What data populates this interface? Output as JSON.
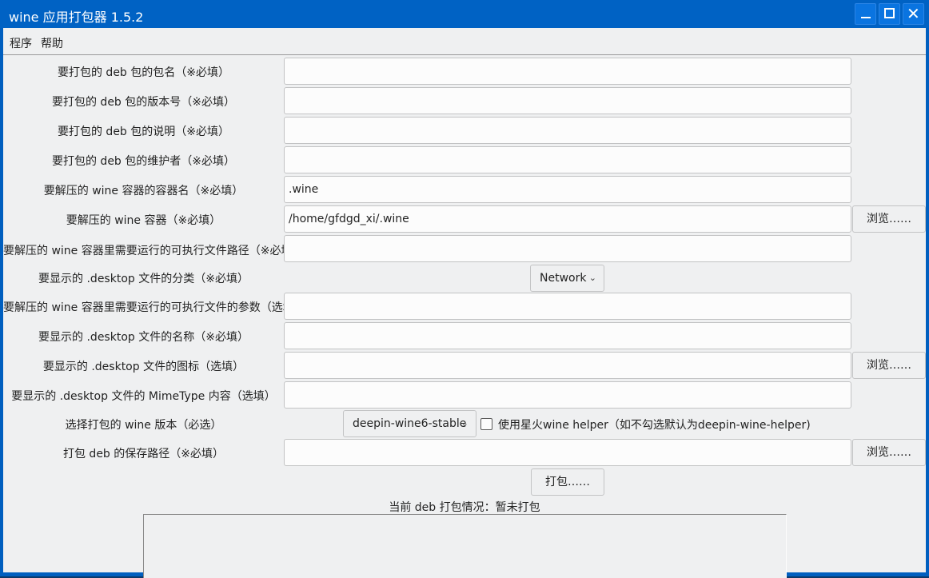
{
  "window": {
    "title": "wine 应用打包器 1.5.2",
    "controls": {
      "minimize": "_",
      "maximize": "□",
      "close": "✕"
    }
  },
  "menubar": {
    "items": [
      {
        "label": "程序"
      },
      {
        "label": "帮助"
      }
    ]
  },
  "form": {
    "package_name": {
      "label": "要打包的 deb 包的包名（※必填）",
      "value": ""
    },
    "version": {
      "label": "要打包的 deb 包的版本号（※必填）",
      "value": ""
    },
    "description": {
      "label": "要打包的 deb 包的说明（※必填）",
      "value": ""
    },
    "maintainer": {
      "label": "要打包的 deb 包的维护者（※必填）",
      "value": ""
    },
    "container_name": {
      "label": "要解压的 wine 容器的容器名（※必填）",
      "value": ".wine"
    },
    "container_path": {
      "label": "要解压的 wine 容器（※必填）",
      "value": "/home/gfdgd_xi/.wine",
      "browse_label": "浏览……"
    },
    "exe_path": {
      "label": "要解压的 wine 容器里需要运行的可执行文件路径（※必填）",
      "value": ""
    },
    "category": {
      "label": "要显示的 .desktop 文件的分类（※必填）",
      "selected": "Network"
    },
    "exe_args": {
      "label": "要解压的 wine 容器里需要运行的可执行文件的参数（选填）",
      "value": ""
    },
    "desktop_name": {
      "label": "要显示的 .desktop 文件的名称（※必填）",
      "value": ""
    },
    "desktop_icon": {
      "label": "要显示的 .desktop 文件的图标（选填）",
      "value": "",
      "browse_label": "浏览……"
    },
    "mimetype": {
      "label": "要显示的 .desktop 文件的 MimeType 内容（选填）",
      "value": ""
    },
    "wine_version": {
      "label": "选择打包的 wine 版本（必选）",
      "selected": "deepin-wine6-stable",
      "helper_checkbox_label": "使用星火wine helper（如不勾选默认为deepin-wine-helper)",
      "helper_checked": false
    },
    "save_path": {
      "label": "打包 deb 的保存路径（※必填）",
      "value": "",
      "browse_label": "浏览……"
    }
  },
  "actions": {
    "pack_label": "打包……"
  },
  "status": {
    "text": "当前 deb 打包情况：暂未打包"
  },
  "log": {
    "content": ""
  }
}
